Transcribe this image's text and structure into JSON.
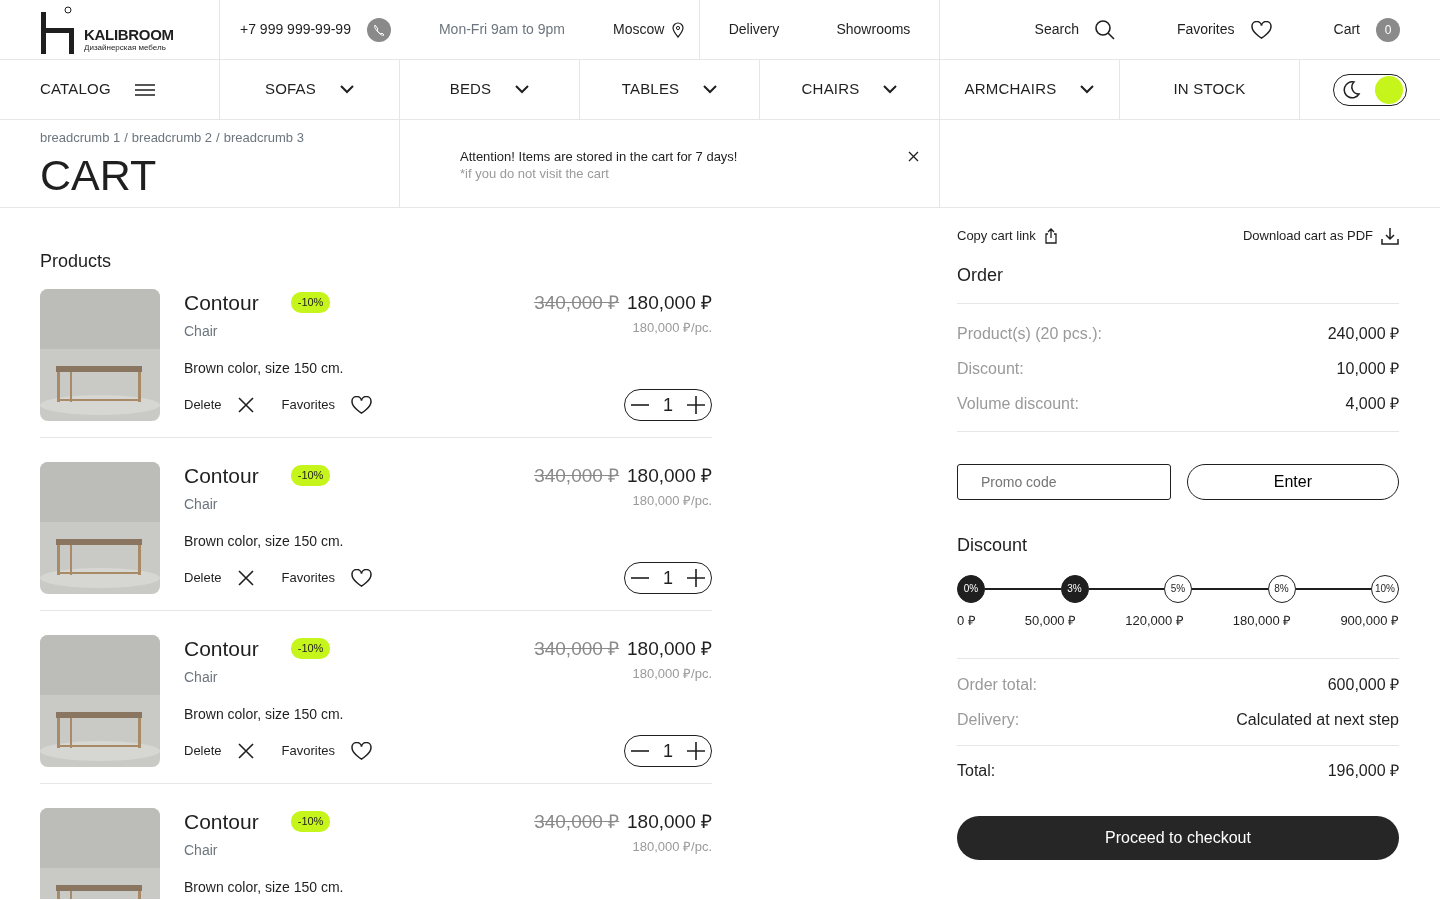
{
  "header": {
    "brand": "KALIBROOM",
    "brand_subtitle": "Дизайнерская мебель",
    "phone": "+7 999 999-99-99",
    "hours": "Mon-Fri 9am to 9pm",
    "city": "Moscow",
    "links": [
      "Delivery",
      "Showrooms"
    ],
    "search": "Search",
    "favorites": "Favorites",
    "cart": "Cart",
    "cart_count": "0"
  },
  "nav": [
    {
      "label": "CATALOG",
      "kind": "menu"
    },
    {
      "label": "SOFAS",
      "kind": "dropdown"
    },
    {
      "label": "BEDS",
      "kind": "dropdown"
    },
    {
      "label": "TABLES",
      "kind": "dropdown"
    },
    {
      "label": "CHAIRS",
      "kind": "dropdown"
    },
    {
      "label": "ARMCHAIRS",
      "kind": "dropdown"
    },
    {
      "label": "IN STOCK",
      "kind": "link"
    }
  ],
  "theme_toggle": {
    "on": true
  },
  "breadcrumbs": [
    "breadcrumb 1",
    "breadcrumb 2",
    "breadcrumb 3"
  ],
  "breadcrumb_separators": [
    "/",
    "/"
  ],
  "page_title": "CART",
  "notice": {
    "text": "Attention! Items are stored in the cart for 7 days!",
    "note": "*if you do not visit the cart"
  },
  "products_title": "Products",
  "products": [
    {
      "name": "Contour",
      "badge": "-10%",
      "type": "Chair",
      "description": "Brown color, size 150 cm.",
      "old_price": "340,000 ₽",
      "price": "180,000 ₽",
      "unit_price": "180,000 ₽/pc.",
      "actions": {
        "delete": "Delete",
        "favorites": "Favorites",
        "quantity": "1"
      }
    },
    {
      "name": "Contour",
      "badge": "-10%",
      "type": "Chair",
      "description": "Brown color, size 150 cm.",
      "old_price": "340,000 ₽",
      "price": "180,000 ₽",
      "unit_price": "180,000 ₽/pc.",
      "actions": {
        "delete": "Delete",
        "favorites": "Favorites",
        "quantity": "1"
      }
    },
    {
      "name": "Contour",
      "badge": "-10%",
      "type": "Chair",
      "description": "Brown color, size 150 cm.",
      "old_price": "340,000 ₽",
      "price": "180,000 ₽",
      "unit_price": "180,000 ₽/pc.",
      "actions": {
        "delete": "Delete",
        "favorites": "Favorites",
        "quantity": "1"
      }
    },
    {
      "name": "Contour",
      "badge": "-10%",
      "type": "Chair",
      "description": "Brown color, size 150 cm.",
      "old_price": "340,000 ₽",
      "price": "180,000 ₽",
      "unit_price": "180,000 ₽/pc."
    }
  ],
  "order": {
    "copy_link": "Copy cart link",
    "download": "Download cart as PDF",
    "title": "Order",
    "lines": [
      {
        "label": "Product(s) (20 pcs.):",
        "value": "240,000 ₽"
      },
      {
        "label": "Discount:",
        "value": "10,000 ₽"
      },
      {
        "label": "Volume discount:",
        "value": "4,000 ₽"
      }
    ],
    "promo_placeholder": "Promo code",
    "enter": "Enter",
    "discount_title": "Discount",
    "steps": [
      {
        "percent": "0%",
        "threshold": "0 ₽",
        "reached": true
      },
      {
        "percent": "3%",
        "threshold": "50,000 ₽",
        "reached": true
      },
      {
        "percent": "5%",
        "threshold": "120,000 ₽",
        "reached": false
      },
      {
        "percent": "8%",
        "threshold": "180,000 ₽",
        "reached": false
      },
      {
        "percent": "10%",
        "threshold": "900,000 ₽",
        "reached": false
      }
    ],
    "totals": [
      {
        "label": "Order total:",
        "value": "600,000 ₽"
      },
      {
        "label": "Delivery:",
        "value": "Calculated at next step"
      }
    ],
    "total": {
      "label": "Total:",
      "value": "196,000 ₽"
    },
    "checkout": "Proceed to checkout"
  }
}
